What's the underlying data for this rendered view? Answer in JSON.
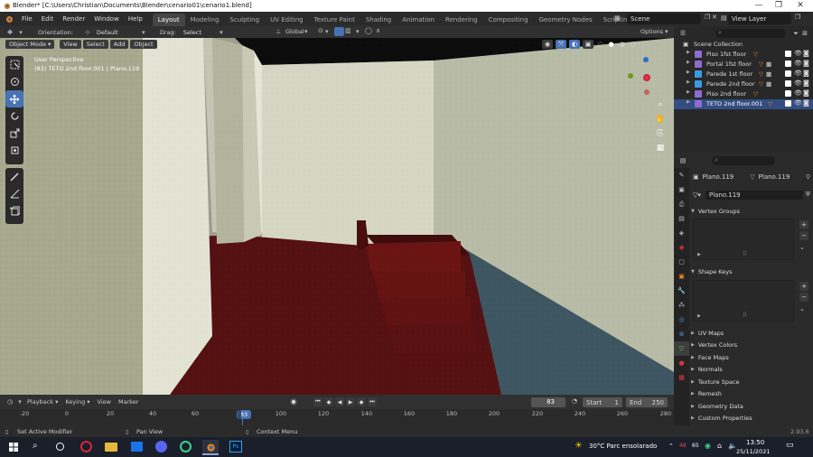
{
  "window": {
    "title": "Blender* [C:\\Users\\Christian\\Documents\\Blender\\cenario01\\cenario1.blend]",
    "minimize": "—",
    "maximize": "❐",
    "close": "✕"
  },
  "menu": [
    "File",
    "Edit",
    "Render",
    "Window",
    "Help"
  ],
  "workspaces": [
    {
      "label": "Layout",
      "active": true
    },
    {
      "label": "Modeling"
    },
    {
      "label": "Sculpting"
    },
    {
      "label": "UV Editing"
    },
    {
      "label": "Texture Paint"
    },
    {
      "label": "Shading"
    },
    {
      "label": "Animation"
    },
    {
      "label": "Rendering"
    },
    {
      "label": "Compositing"
    },
    {
      "label": "Geometry Nodes"
    },
    {
      "label": "Scripting"
    }
  ],
  "add_workspace": "+",
  "scene": {
    "label": "Scene"
  },
  "view_layer": {
    "label": "View Layer"
  },
  "toolheader": {
    "orientation_label": "Orientation:",
    "orientation_value": "Default",
    "drag_label": "Drag:",
    "drag_value": "Select Box",
    "transform_orientation": "Global",
    "options": "Options"
  },
  "viewport_header": {
    "mode": "Object Mode",
    "view": "View",
    "select": "Select",
    "add": "Add",
    "object": "Object"
  },
  "viewport_overlay_text": {
    "perspective": "User Perspective",
    "object_info": "(83) TETO 2nd floor.001 | Plano.119"
  },
  "outliner": {
    "collection": "Scene Collection",
    "items": [
      "Piso 1fst floor",
      "Portal 1fst floor",
      "Parede 1st floor",
      "Parede 2nd floor",
      "Piso 2nd floor",
      "TETO 2nd floor.001"
    ]
  },
  "properties": {
    "search_placeholder": "",
    "object_name": "Plano.119",
    "mesh_name": "Plano.119",
    "data_field": "Plano.119",
    "panels": {
      "vertex_groups": "Vertex Groups",
      "shape_keys": "Shape Keys",
      "uv_maps": "UV Maps",
      "vertex_colors": "Vertex Colors",
      "face_maps": "Face Maps",
      "normals": "Normals",
      "texture_space": "Texture Space",
      "remesh": "Remesh",
      "geometry_data": "Geometry Data",
      "custom_properties": "Custom Properties"
    }
  },
  "timeline": {
    "playback": "Playback",
    "keying": "Keying",
    "view": "View",
    "marker": "Marker",
    "current_frame": "83",
    "start_label": "Start",
    "start_value": "1",
    "end_label": "End",
    "end_value": "250",
    "ticks": [
      "-20",
      "0",
      "20",
      "40",
      "60",
      "83",
      "100",
      "120",
      "140",
      "160",
      "180",
      "200",
      "220",
      "240",
      "260",
      "280"
    ],
    "playhead": "83"
  },
  "statusbar": {
    "left": "Set Active Modifier",
    "middle": "Pan View",
    "right": "Context Menu",
    "version": "2.93.6"
  },
  "taskbar": {
    "weather": "30°C  Parc ensolarado",
    "time": "13:50",
    "date": "25/11/2021",
    "badge_red": "48",
    "badge_num": "65"
  },
  "colors": {
    "accent": "#4772b3",
    "floor": "#5a1010",
    "wall": "#d7d8c6",
    "water": "#3c5560",
    "orange": "#e8852d"
  }
}
